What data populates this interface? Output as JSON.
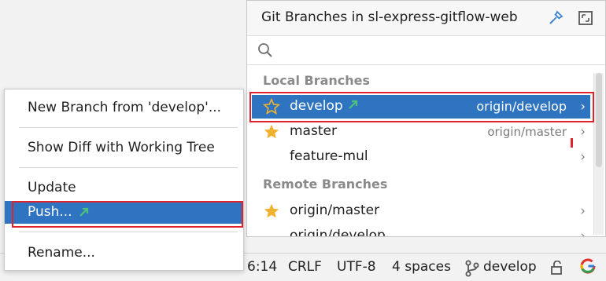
{
  "popup": {
    "title": "Git Branches in sl-express-gitflow-web",
    "search": {
      "value": "",
      "placeholder": ""
    },
    "local_group": "Local Branches",
    "remote_group": "Remote Branches",
    "local_branches": [
      {
        "name": "develop",
        "tracking": "origin/develop",
        "favorite": true,
        "selected": true
      },
      {
        "name": "master",
        "tracking": "origin/master",
        "favorite": true,
        "selected": false
      },
      {
        "name": "feature-mul",
        "tracking": "",
        "favorite": false,
        "selected": false
      }
    ],
    "remote_branches": [
      {
        "name": "origin/master",
        "favorite": true
      },
      {
        "name": "origin/develop",
        "favorite": false
      }
    ]
  },
  "context_menu": {
    "items": [
      {
        "label": "New Branch from 'develop'..."
      },
      {
        "label": "Show Diff with Working Tree"
      },
      {
        "label": "Update"
      },
      {
        "label": "Push...",
        "selected": true
      },
      {
        "label": "Rename..."
      }
    ]
  },
  "statusbar": {
    "position": "6:14",
    "line_sep": "CRLF",
    "encoding": "UTF-8",
    "indent": "4 spaces",
    "branch": "develop"
  },
  "colors": {
    "selection": "#2f74c0",
    "star": "#f0b030",
    "outgoing_arrow": "#3aa860",
    "highlight_box": "#e0222a"
  },
  "icons": {
    "header_pin": "pin-icon",
    "header_window": "window-icon",
    "search": "search-icon",
    "favorite": "star-icon",
    "outgoing": "outgoing-arrow-icon",
    "submenu": "chevron-right-icon",
    "branch": "git-branch-icon",
    "lock": "lock-icon",
    "google": "google-icon"
  }
}
